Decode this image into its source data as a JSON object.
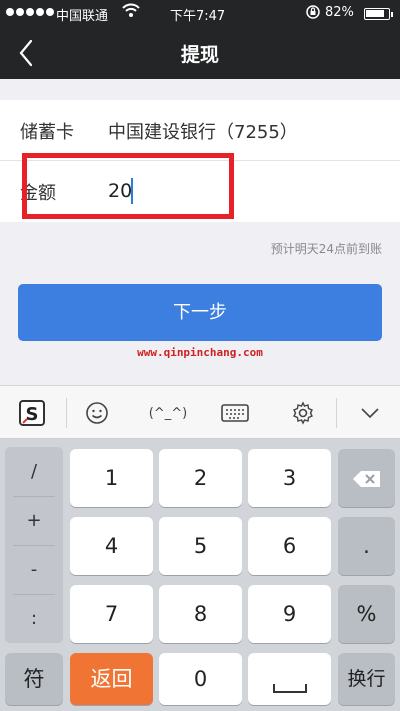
{
  "status_bar": {
    "carrier": "中国联通",
    "time": "下午7:47",
    "battery_percent": "82%",
    "battery_level": 0.82
  },
  "nav": {
    "title": "提现"
  },
  "form": {
    "card_label": "储蓄卡",
    "card_value": "中国建设银行（7255）",
    "amount_label": "金额",
    "amount_value": "20"
  },
  "hint": "预计明天24点前到账",
  "next_button": "下一步",
  "watermark": "www.qinpinchang.com",
  "keyboard": {
    "toolbar": {
      "emoticon": "(^_^)"
    },
    "side_keys": [
      "/",
      "+",
      "-",
      ":"
    ],
    "digit_rows": [
      [
        "1",
        "2",
        "3"
      ],
      [
        "4",
        "5",
        "6"
      ],
      [
        "7",
        "8",
        "9"
      ]
    ],
    "right_keys": [
      ".",
      "%"
    ],
    "bottom": {
      "symbol": "符",
      "back": "返回",
      "zero": "0",
      "newline": "换行"
    },
    "colors": {
      "return_key": "#f07535",
      "next_button": "#3c7fe0",
      "highlight_box": "#e8202a"
    }
  }
}
